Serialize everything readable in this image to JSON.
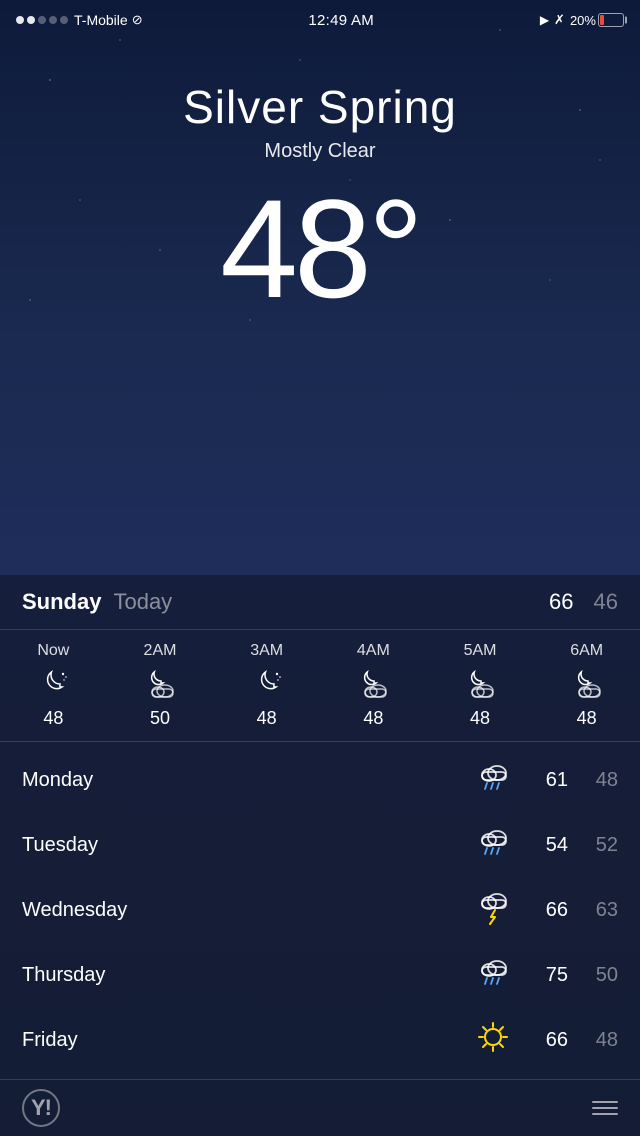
{
  "statusBar": {
    "carrier": "T-Mobile",
    "time": "12:49 AM",
    "battery": "20%",
    "signalDots": [
      true,
      true,
      false,
      false,
      false
    ]
  },
  "weather": {
    "city": "Silver Spring",
    "condition": "Mostly Clear",
    "temperature": "48°",
    "today": {
      "day": "Sunday",
      "label": "Today",
      "high": "66",
      "low": "46"
    }
  },
  "hourly": [
    {
      "label": "Now",
      "icon": "clear-night",
      "temp": "48"
    },
    {
      "label": "2AM",
      "icon": "partly-cloudy-night",
      "temp": "50"
    },
    {
      "label": "3AM",
      "icon": "clear-night",
      "temp": "48"
    },
    {
      "label": "4AM",
      "icon": "partly-cloudy-night",
      "temp": "48"
    },
    {
      "label": "5AM",
      "icon": "partly-cloudy-night",
      "temp": "48"
    },
    {
      "label": "6AM",
      "icon": "partly-cloudy-night",
      "temp": "48"
    }
  ],
  "daily": [
    {
      "day": "Monday",
      "icon": "rain",
      "high": "61",
      "low": "48"
    },
    {
      "day": "Tuesday",
      "icon": "rain",
      "high": "54",
      "low": "52"
    },
    {
      "day": "Wednesday",
      "icon": "storm",
      "high": "66",
      "low": "63"
    },
    {
      "day": "Thursday",
      "icon": "rain",
      "high": "75",
      "low": "50"
    },
    {
      "day": "Friday",
      "icon": "sunny",
      "high": "66",
      "low": "48"
    }
  ],
  "footer": {
    "logo": "Y!",
    "menu_label": "menu"
  }
}
